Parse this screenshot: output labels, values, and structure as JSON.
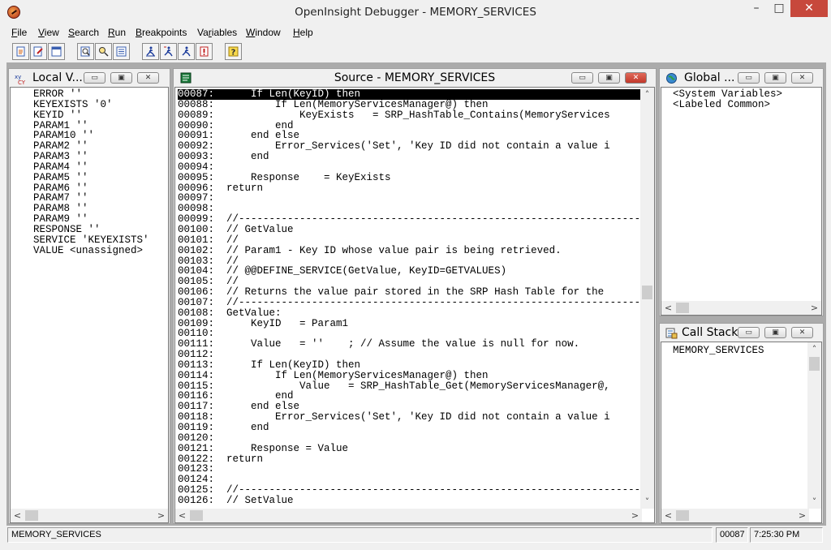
{
  "window": {
    "title": "OpenInsight Debugger - MEMORY_SERVICES",
    "minimize": "–",
    "maximize": "□",
    "close": "✕"
  },
  "menu": [
    {
      "label": "File",
      "u": "F",
      "rest": "ile"
    },
    {
      "label": "View",
      "u": "V",
      "rest": "iew"
    },
    {
      "label": "Search",
      "u": "S",
      "rest": "earch"
    },
    {
      "label": "Run",
      "u": "R",
      "rest": "un"
    },
    {
      "label": "Breakpoints",
      "u": "B",
      "rest": "reakpoints"
    },
    {
      "label": "Variables",
      "u": "V",
      "rest": "ariables",
      "prefix": "Va",
      "urest": "r",
      "tail": "iables"
    },
    {
      "label": "Window",
      "u": "W",
      "rest": "indow"
    },
    {
      "label": "Help",
      "u": "H",
      "rest": "elp"
    }
  ],
  "toolbar": {
    "icons": [
      "open-file-icon",
      "edit-icon",
      "window-icon",
      "find-icon",
      "find-next-icon",
      "list-icon",
      "step-icon",
      "step-over-icon",
      "run-icon",
      "stop-icon",
      "help-icon"
    ]
  },
  "local_vars": {
    "title": "Local V...",
    "items": [
      "ERROR ''",
      "KEYEXISTS '0'",
      "KEYID ''",
      "PARAM1 ''",
      "PARAM10 ''",
      "PARAM2 ''",
      "PARAM3 ''",
      "PARAM4 ''",
      "PARAM5 ''",
      "PARAM6 ''",
      "PARAM7 ''",
      "PARAM8 ''",
      "PARAM9 ''",
      "RESPONSE ''",
      "SERVICE 'KEYEXISTS'",
      "VALUE <unassigned>"
    ]
  },
  "source": {
    "title": "Source - MEMORY_SERVICES",
    "selected_line": "00087",
    "lines": [
      "00087:      If Len(KeyID) then",
      "00088:          If Len(MemoryServicesManager@) then",
      "00089:              KeyExists   = SRP_HashTable_Contains(MemoryServices",
      "00090:          end",
      "00091:      end else",
      "00092:          Error_Services('Set', 'Key ID did not contain a value i",
      "00093:      end",
      "00094:",
      "00095:      Response    = KeyExists",
      "00096:  return",
      "00097:",
      "00098:",
      "00099:  //----------------------------------------------------------------------",
      "00100:  // GetValue",
      "00101:  //",
      "00102:  // Param1 - Key ID whose value pair is being retrieved.",
      "00103:  //",
      "00104:  // @@DEFINE_SERVICE(GetValue, KeyID=GETVALUES)",
      "00105:  //",
      "00106:  // Returns the value pair stored in the SRP Hash Table for the",
      "00107:  //----------------------------------------------------------------------",
      "00108:  GetValue:",
      "00109:      KeyID   = Param1",
      "00110:",
      "00111:      Value   = ''    ; // Assume the value is null for now.",
      "00112:",
      "00113:      If Len(KeyID) then",
      "00114:          If Len(MemoryServicesManager@) then",
      "00115:              Value   = SRP_HashTable_Get(MemoryServicesManager@,",
      "00116:          end",
      "00117:      end else",
      "00118:          Error_Services('Set', 'Key ID did not contain a value i",
      "00119:      end",
      "00120:",
      "00121:      Response = Value",
      "00122:  return",
      "00123:",
      "00124:",
      "00125:  //----------------------------------------------------------------------",
      "00126:  // SetValue"
    ]
  },
  "global_vars": {
    "title": "Global ...",
    "items": [
      "<System Variables>",
      "<Labeled Common>"
    ]
  },
  "call_stack": {
    "title": "Call Stack",
    "items": [
      "MEMORY_SERVICES"
    ]
  },
  "status": {
    "program": "MEMORY_SERVICES",
    "line": "00087",
    "time": "7:25:30 PM"
  }
}
